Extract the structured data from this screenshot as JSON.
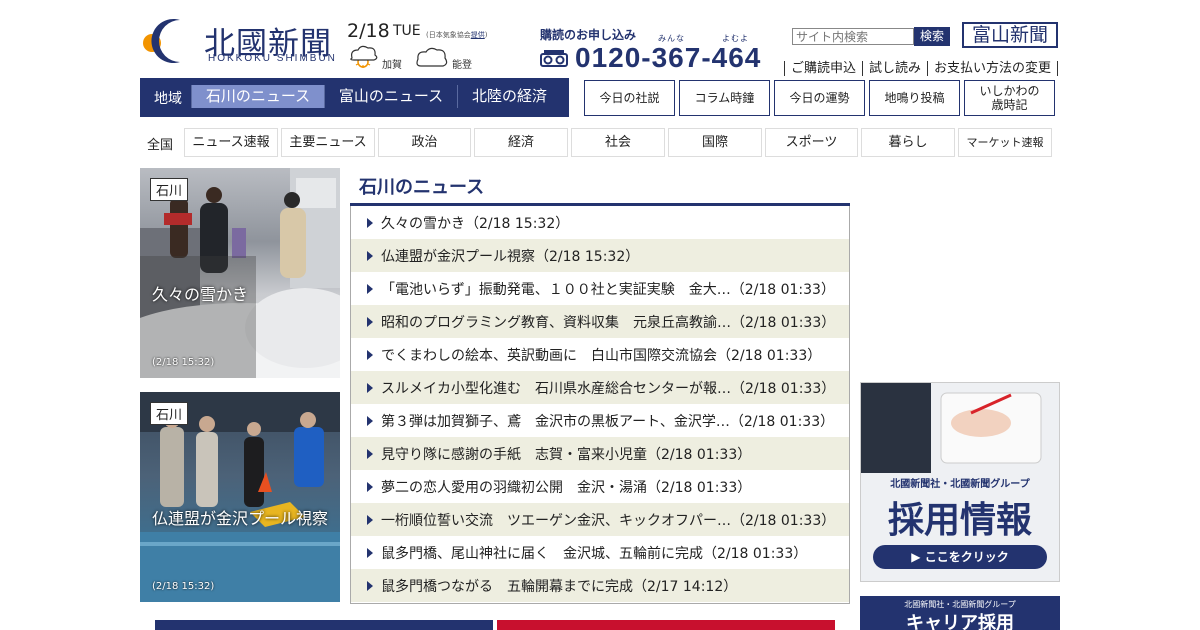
{
  "header": {
    "logo_jp": "北國新聞",
    "logo_en": "HOKKOKU SHIMBUN",
    "date": "2/18",
    "dow": "TUE",
    "weather_source_prefix": "(日本気象協会",
    "weather_source_link": "提供",
    "weather_source_suffix": ")",
    "weather": [
      {
        "icon": "cloud-sun-icon",
        "label": "加賀"
      },
      {
        "icon": "cloud-icon",
        "label": "能登"
      }
    ],
    "subscribe_title": "購読のお申し込み",
    "phone": "0120-367-464",
    "phone_ruby": [
      "みんな",
      "よむよ"
    ],
    "search_placeholder": "サイト内検索",
    "search_button": "検索",
    "toyama_logo": "富山新聞",
    "links": [
      "ご購読申込",
      "試し読み",
      "お支払い方法の変更"
    ]
  },
  "region_nav": {
    "label": "地域",
    "tabs": [
      "石川のニュース",
      "富山のニュース",
      "北陸の経済"
    ],
    "active": "石川のニュース"
  },
  "box_buttons": [
    "今日の社説",
    "コラム時鐘",
    "今日の運勢",
    "地鳴り投稿",
    "いしかわの\n歳時記"
  ],
  "categories": {
    "label": "全国",
    "items": [
      "ニュース速報",
      "主要ニュース",
      "政治",
      "経済",
      "社会",
      "国際",
      "スポーツ",
      "暮らし",
      "マーケット速報"
    ]
  },
  "photos": [
    {
      "tag": "石川",
      "title": "久々の雪かき",
      "time": "(2/18 15:32)"
    },
    {
      "tag": "石川",
      "title": "仏連盟が金沢プール視察",
      "time": "(2/18 15:32)"
    }
  ],
  "news": {
    "title": "石川のニュース",
    "items": [
      "久々の雪かき（2/18 15:32）",
      "仏連盟が金沢プール視察（2/18 15:32）",
      "「電池いらず」振動発電、１００社と実証実験　金大…（2/18 01:33）",
      "昭和のプログラミング教育、資料収集　元泉丘高教諭…（2/18 01:33）",
      "でくまわしの絵本、英訳動画に　白山市国際交流協会（2/18 01:33）",
      "スルメイカ小型化進む　石川県水産総合センターが報…（2/18 01:33）",
      "第３弾は加賀獅子、鳶　金沢市の黒板アート、金沢学…（2/18 01:33）",
      "見守り隊に感謝の手紙　志賀・富来小児童（2/18 01:33）",
      "夢二の恋人愛用の羽織初公開　金沢・湯涌（2/18 01:33）",
      "一桁順位誓い交流　ツエーゲン金沢、キックオフパー…（2/18 01:33）",
      "鼠多門橋、尾山神社に届く　金沢城、五輪前に完成（2/18 01:33）",
      "鼠多門橋つながる　五輪開幕までに完成（2/17 14:12）"
    ]
  },
  "ads": {
    "recruit_small": "北國新聞社・北國新聞グループ",
    "recruit_title": "採用情報",
    "recruit_button": "▶ ここをクリック",
    "career_small": "北國新聞社・北國新聞グループ",
    "career_title": "キャリア採用"
  },
  "colors": {
    "navy": "#23336f",
    "active_tab": "#7f90cc",
    "alt_row": "#eeeee0"
  }
}
